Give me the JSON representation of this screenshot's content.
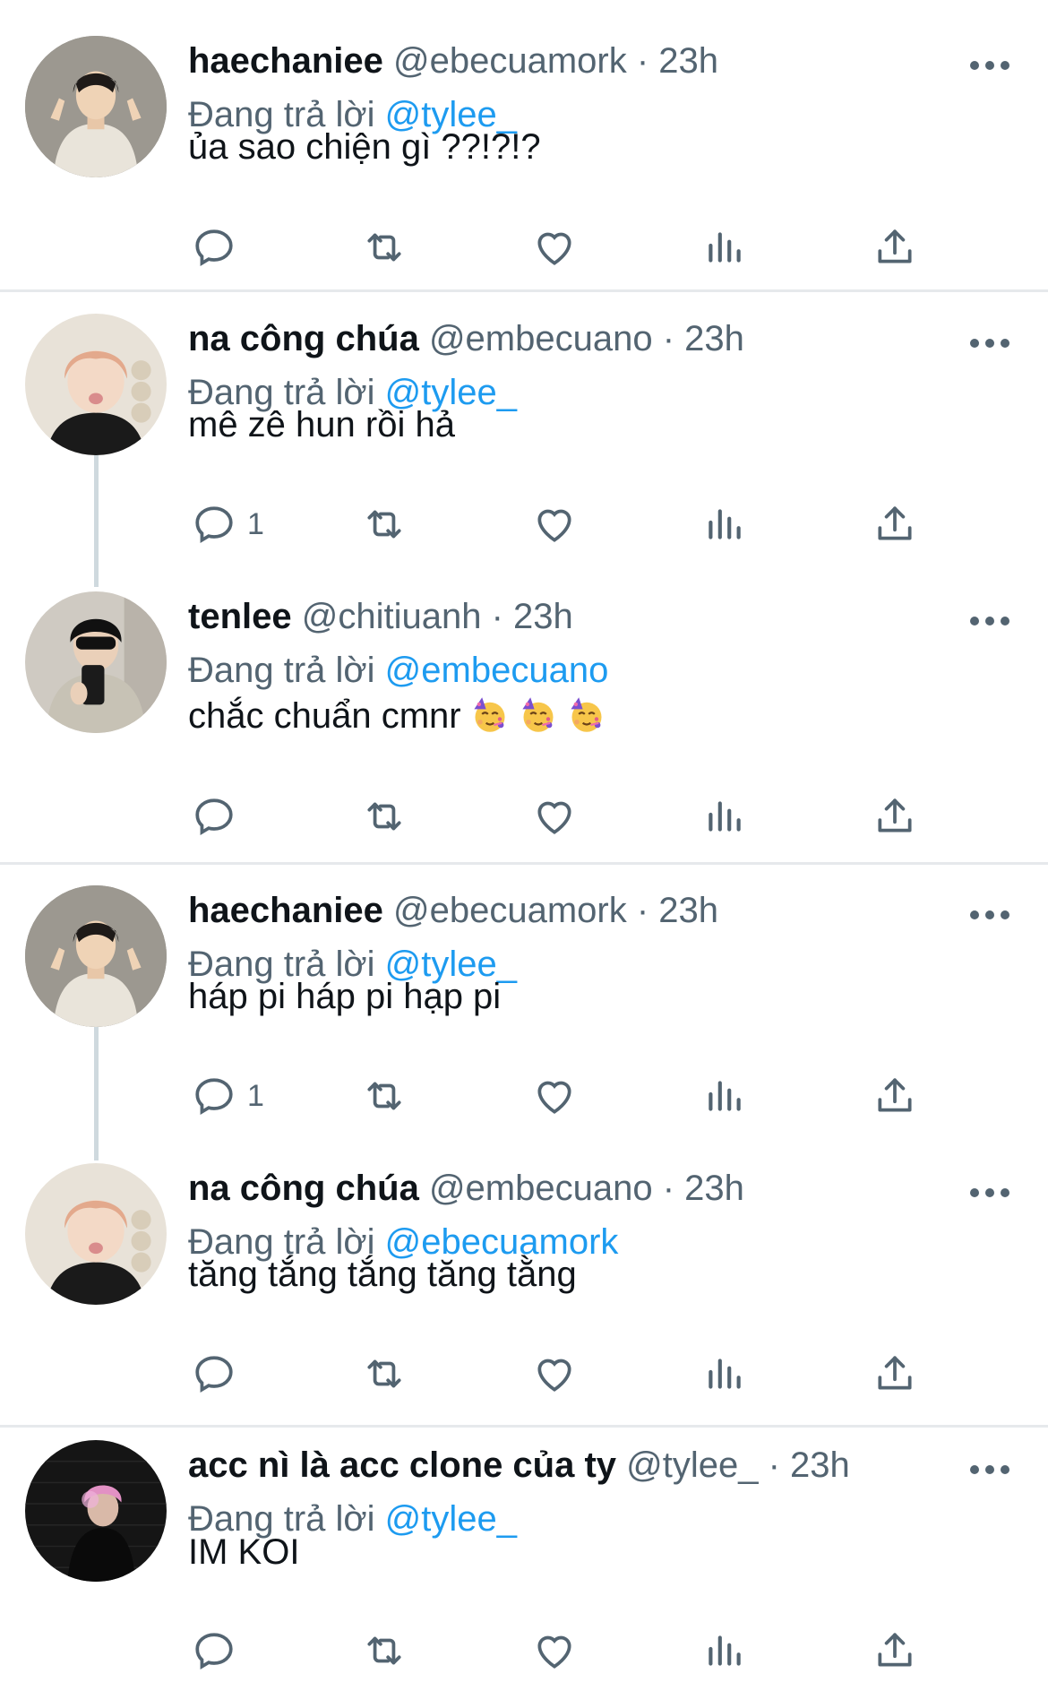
{
  "reply_prefix": "Đang trả lời",
  "tweets": [
    {
      "name": "haechaniee",
      "handle": "@ebecuamork",
      "time": "23h",
      "replying_to": "@tylee_",
      "text": "ủa sao chiện gì ??!?!?",
      "reply_count": "",
      "avatar": "avatar-boy-peace"
    },
    {
      "name": "na công chúa",
      "handle": "@embecuano",
      "time": "23h",
      "replying_to": "@tylee_",
      "text": "mê zê hun rồi hả",
      "reply_count": "1",
      "avatar": "avatar-pink-hair"
    },
    {
      "name": "tenlee",
      "handle": "@chitiuanh",
      "time": "23h",
      "replying_to": "@embecuano",
      "text": "chắc chuẩn cmnr",
      "reply_count": "",
      "avatar": "avatar-mirror-selfie",
      "emoji": "partying-face"
    },
    {
      "name": "haechaniee",
      "handle": "@ebecuamork",
      "time": "23h",
      "replying_to": "@tylee_",
      "text": "háp pi háp pi hạp pi",
      "reply_count": "1",
      "avatar": "avatar-boy-peace"
    },
    {
      "name": "na công chúa",
      "handle": "@embecuano",
      "time": "23h",
      "replying_to": "@ebecuamork",
      "text": "tăng tắng tắng tăng tằng",
      "reply_count": "",
      "avatar": "avatar-pink-hair"
    },
    {
      "name": "acc nì là acc clone của ty",
      "handle": "@tylee_",
      "time": "23h",
      "replying_to": "@tylee_",
      "text": "IM KOI",
      "reply_count": "",
      "avatar": "avatar-dark-stage"
    }
  ],
  "colors": {
    "mention": "#1d9bf0",
    "muted": "#536471",
    "divider": "#e6e9ec"
  }
}
